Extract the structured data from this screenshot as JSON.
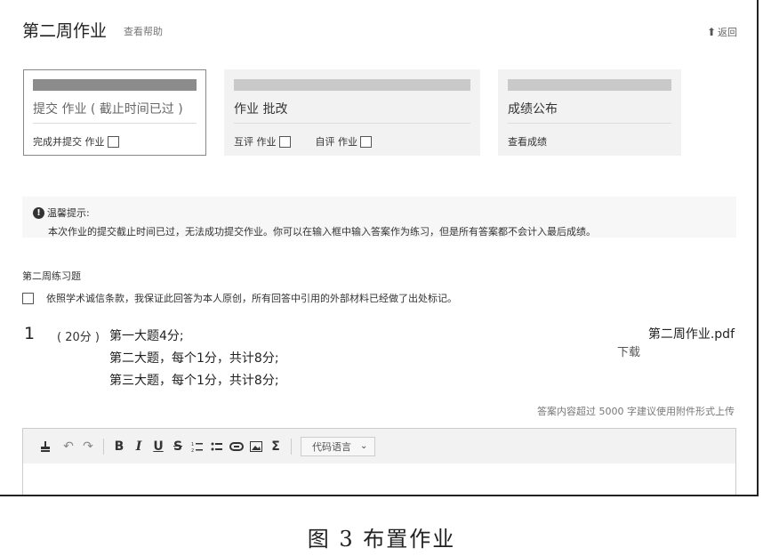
{
  "header": {
    "title": "第二周作业",
    "help_link": "查看帮助",
    "back_label": "返回"
  },
  "steps": [
    {
      "title": "提交 作业 ( 截止时间已过 )",
      "actions": [
        "完成并提交 作业"
      ]
    },
    {
      "title": "作业 批改",
      "actions": [
        "互评 作业",
        "自评 作业"
      ]
    },
    {
      "title": "成绩公布",
      "actions": [
        "查看成绩"
      ]
    }
  ],
  "notice": {
    "title": "温馨提示:",
    "body": "本次作业的提交截止时间已过，无法成功提交作业。你可以在输入框中输入答案作为练习，但是所有答案都不会计入最后成绩。"
  },
  "exercise": {
    "section_title": "第二周练习题",
    "pledge": "依照学术诚信条款，我保证此回答为本人原创，所有回答中引用的外部材料已经做了出处标记。",
    "question": {
      "number": "1",
      "score": "( 20分 )",
      "lines": [
        "第一大题4分;",
        "第二大题，每个1分，共计8分;",
        "第三大题，每个1分，共计8分;"
      ]
    },
    "attachment": {
      "name": "第二周作业.pdf",
      "download_label": "下载"
    },
    "length_hint": "答案内容超过 5000 字建议使用附件形式上传"
  },
  "editor": {
    "tools": [
      {
        "name": "format-painter-icon",
        "glyph": "🖌"
      },
      {
        "name": "undo-icon",
        "glyph": "↶"
      },
      {
        "name": "redo-icon",
        "glyph": "↷"
      },
      {
        "name": "bold-icon",
        "glyph": "B"
      },
      {
        "name": "italic-icon",
        "glyph": "I"
      },
      {
        "name": "underline-icon",
        "glyph": "U"
      },
      {
        "name": "strikethrough-icon",
        "glyph": "S"
      },
      {
        "name": "ordered-list-icon",
        "glyph": "⒈"
      },
      {
        "name": "bullet-list-icon",
        "glyph": "≔"
      },
      {
        "name": "link-icon",
        "glyph": "⊂⊃"
      },
      {
        "name": "image-icon",
        "glyph": "▣"
      },
      {
        "name": "formula-icon",
        "glyph": "Σ"
      }
    ],
    "code_language_label": "代码语言"
  },
  "caption": "图 3   布置作业",
  "colors": {
    "accent_gray": "#8c8c8c",
    "card_bg": "#f2f2f2",
    "notice_bg": "#f7f7f7"
  }
}
